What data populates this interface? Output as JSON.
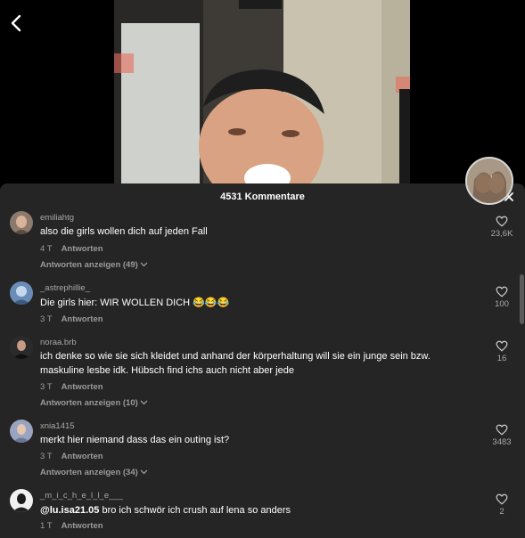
{
  "panel": {
    "title": "4531 Kommentare"
  },
  "comments": [
    {
      "username": "emiliahtg",
      "text": "also die girls wollen dich auf jeden Fall",
      "mention": "",
      "time": "4 T",
      "reply": "Antworten",
      "view_replies": "Antworten anzeigen (49)",
      "likes": "23,6K"
    },
    {
      "username": "_astrephillie_",
      "text": "Die girls hier: WIR WOLLEN DICH 😂😂😂",
      "mention": "",
      "time": "3 T",
      "reply": "Antworten",
      "view_replies": "",
      "likes": "100"
    },
    {
      "username": "noraa.brb",
      "text": "ich denke so wie sie sich kleidet und anhand der körperhaltung will sie ein junge sein bzw. maskuline lesbe idk. Hübsch find ichs auch nicht aber jede",
      "mention": "",
      "time": "3 T",
      "reply": "Antworten",
      "view_replies": "Antworten anzeigen (10)",
      "likes": "16"
    },
    {
      "username": "xnia1415",
      "text": "merkt hier niemand dass das ein outing ist?",
      "mention": "",
      "time": "3 T",
      "reply": "Antworten",
      "view_replies": "Antworten anzeigen (34)",
      "likes": "3483"
    },
    {
      "username": "_m_i_c_h_e_l_l_e___",
      "text": " bro ich schwör ich crush auf lena so anders",
      "mention": "@lu.isa21.05",
      "time": "1 T",
      "reply": "Antworten",
      "view_replies": "",
      "likes": "2"
    }
  ],
  "icons": {
    "back": "chevron-left-icon",
    "close": "close-icon",
    "like": "heart-icon"
  }
}
